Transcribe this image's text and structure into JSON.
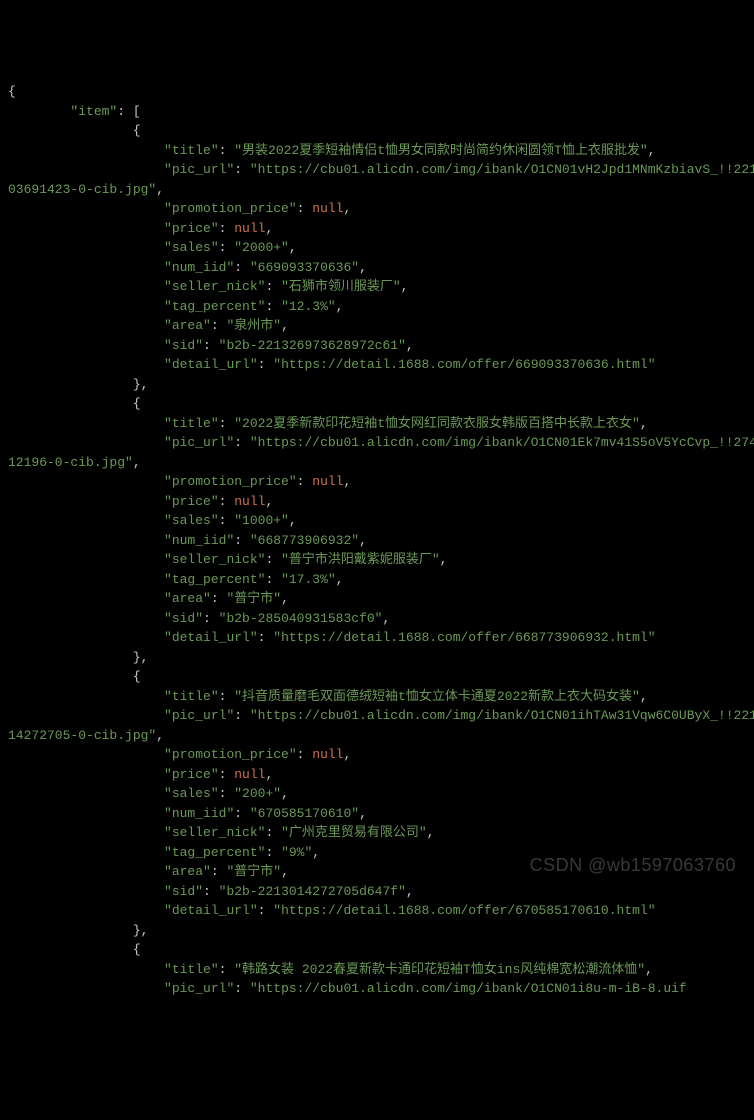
{
  "watermark": "CSDN @wb1597063760",
  "json_view": {
    "open_brace": "{",
    "close_brace": "}",
    "comma": ",",
    "colon": ": ",
    "open_bracket": "[",
    "close_bracket": "]",
    "null_literal": "null",
    "item_key": "\"item\"",
    "items": [
      {
        "title": "\"男装2022夏季短袖情侣t恤男女同款时尚简约休闲圆领T恤上衣服批发\"",
        "pic_url_line1": "\"https://cbu01.alicdn.com/img/ibank/O1CN01vH2Jpd1MNmKzbiavS_!!22132",
        "pic_url_line2": "03691423-0-cib.jpg\"",
        "sales": "\"2000+\"",
        "num_iid": "\"669093370636\"",
        "seller_nick": "\"石狮市领川服装厂\"",
        "tag_percent": "\"12.3%\"",
        "area": "\"泉州市\"",
        "sid": "\"b2b-221326973628972c61\"",
        "detail_url": "\"https://detail.1688.com/offer/669093370636.html\""
      },
      {
        "title": "\"2022夏季新款印花短袖t恤女网红同款衣服女韩版百搭中长款上衣女\"",
        "pic_url_line1": "\"https://cbu01.alicdn.com/img/ibank/O1CN01Ek7mv41S5oV5YcCvp_!!27443",
        "pic_url_line2": "12196-0-cib.jpg\"",
        "sales": "\"1000+\"",
        "num_iid": "\"668773906932\"",
        "seller_nick": "\"普宁市洪阳戴紫妮服装厂\"",
        "tag_percent": "\"17.3%\"",
        "area": "\"普宁市\"",
        "sid": "\"b2b-285040931583cf0\"",
        "detail_url": "\"https://detail.1688.com/offer/668773906932.html\""
      },
      {
        "title": "\"抖音质量磨毛双面德绒短袖t恤女立体卡通夏2022新款上衣大码女装\"",
        "pic_url_line1": "\"https://cbu01.alicdn.com/img/ibank/O1CN01ihTAw31Vqw6C0UByX_!!22130",
        "pic_url_line2": "14272705-0-cib.jpg\"",
        "sales": "\"200+\"",
        "num_iid": "\"670585170610\"",
        "seller_nick": "\"广州克里贸易有限公司\"",
        "tag_percent": "\"9%\"",
        "area": "\"普宁市\"",
        "sid": "\"b2b-2213014272705d647f\"",
        "detail_url": "\"https://detail.1688.com/offer/670585170610.html\""
      },
      {
        "title": "\"韩路女装 2022春夏新款卡通印花短袖T恤女ins风纯棉宽松潮流体恤\"",
        "pic_url_line1": "\"https://cbu01.alicdn.com/img/ibank/O1CN01i8u-m-iB-8.uif"
      }
    ],
    "keys": {
      "title": "\"title\"",
      "pic_url": "\"pic_url\"",
      "promotion_price": "\"promotion_price\"",
      "price": "\"price\"",
      "sales": "\"sales\"",
      "num_iid": "\"num_iid\"",
      "seller_nick": "\"seller_nick\"",
      "tag_percent": "\"tag_percent\"",
      "area": "\"area\"",
      "sid": "\"sid\"",
      "detail_url": "\"detail_url\""
    }
  }
}
